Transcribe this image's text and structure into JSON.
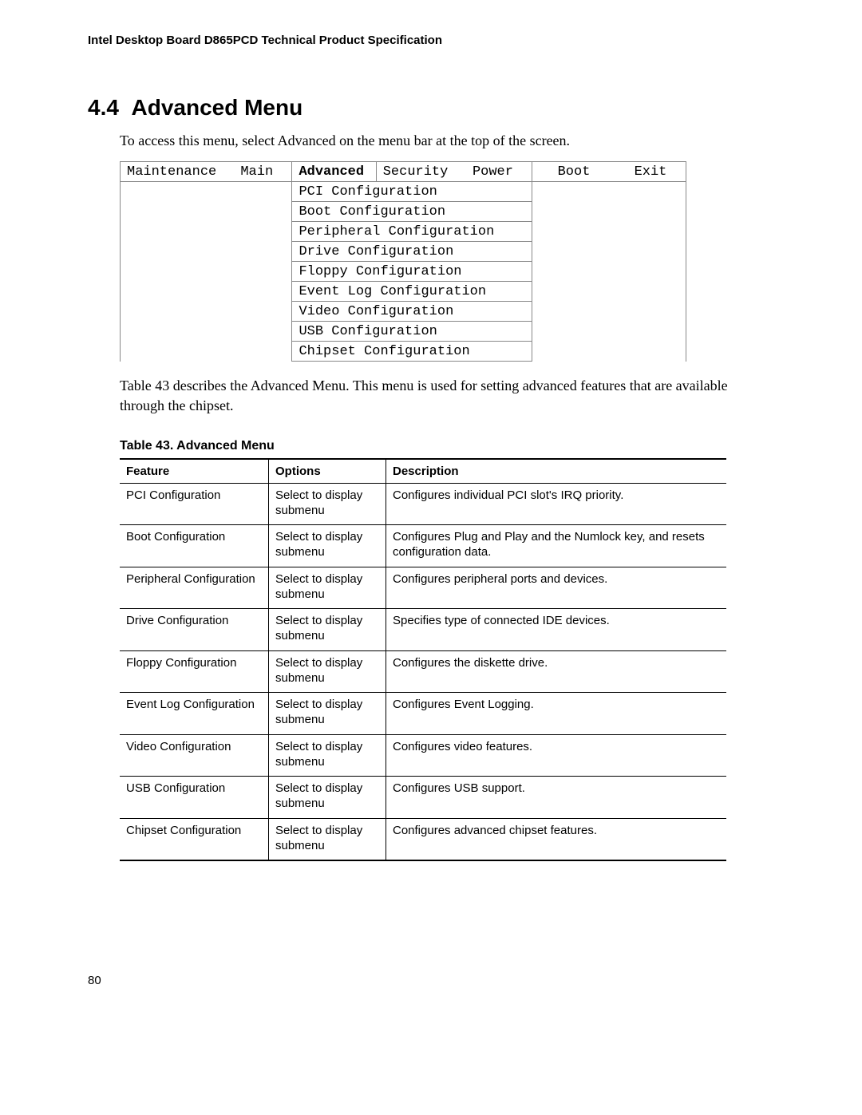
{
  "header": "Intel Desktop Board D865PCD Technical Product Specification",
  "section_number": "4.4",
  "section_title": "Advanced Menu",
  "intro": "To access this menu, select Advanced on the menu bar at the top of the screen.",
  "menu_bar": {
    "items": [
      "Maintenance",
      "Main",
      "Advanced",
      "Security",
      "Power",
      "Boot",
      "Exit"
    ],
    "selected_index": 2
  },
  "submenu_items": [
    "PCI Configuration",
    "Boot Configuration",
    "Peripheral Configuration",
    "Drive Configuration",
    "Floppy Configuration",
    "Event Log Configuration",
    "Video Configuration",
    "USB Configuration",
    "Chipset Configuration"
  ],
  "table_ref_text": "Table 43 describes the Advanced Menu.  This menu is used for setting advanced features that are available through the chipset.",
  "table_caption": "Table 43.    Advanced Menu",
  "table_headers": {
    "feature": "Feature",
    "options": "Options",
    "description": "Description"
  },
  "table_rows": [
    {
      "feature": "PCI Configuration",
      "options": "Select to display submenu",
      "description": "Configures individual PCI slot's IRQ priority."
    },
    {
      "feature": "Boot Configuration",
      "options": "Select to display submenu",
      "description": "Configures Plug and Play and the Numlock key, and resets configuration data."
    },
    {
      "feature": "Peripheral Configuration",
      "options": "Select to display submenu",
      "description": "Configures peripheral ports and devices."
    },
    {
      "feature": "Drive Configuration",
      "options": "Select to display submenu",
      "description": "Specifies type of connected IDE devices."
    },
    {
      "feature": "Floppy Configuration",
      "options": "Select to display submenu",
      "description": "Configures the diskette drive."
    },
    {
      "feature": "Event Log Configuration",
      "options": "Select to display submenu",
      "description": "Configures Event Logging."
    },
    {
      "feature": "Video Configuration",
      "options": "Select to display submenu",
      "description": "Configures video features."
    },
    {
      "feature": "USB Configuration",
      "options": "Select to display submenu",
      "description": "Configures USB support."
    },
    {
      "feature": "Chipset Configuration",
      "options": "Select to display submenu",
      "description": "Configures advanced chipset features."
    }
  ],
  "page_number": "80"
}
